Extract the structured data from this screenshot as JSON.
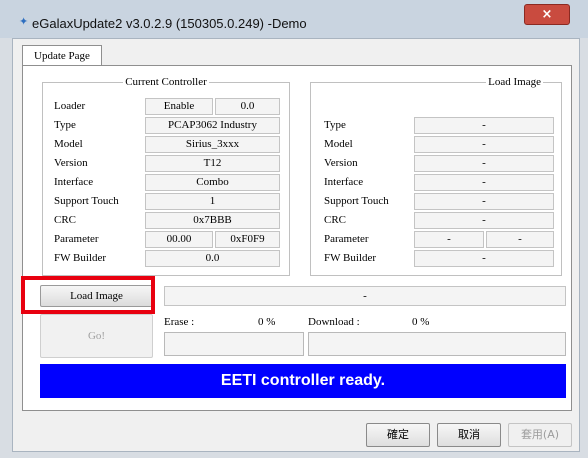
{
  "window": {
    "title": "eGalaxUpdate2 v3.0.2.9 (150305.0.249) -Demo",
    "close_glyph": "×"
  },
  "tabs": [
    {
      "label": "Update Page"
    }
  ],
  "current_controller": {
    "legend": "Current Controller",
    "rows": [
      {
        "label": "Loader",
        "value": "Enable",
        "value2": "0.0"
      },
      {
        "label": "Type",
        "value": "PCAP3062 Industry"
      },
      {
        "label": "Model",
        "value": "Sirius_3xxx"
      },
      {
        "label": "Version",
        "value": "T12"
      },
      {
        "label": "Interface",
        "value": "Combo"
      },
      {
        "label": "Support Touch",
        "value": "1"
      },
      {
        "label": "CRC",
        "value": "0x7BBB"
      },
      {
        "label": "Parameter",
        "value": "00.00",
        "value2": "0xF0F9"
      },
      {
        "label": "FW Builder",
        "value": "0.0"
      }
    ]
  },
  "load_image": {
    "legend": "Load Image",
    "rows": [
      {
        "label": "Type",
        "value": "-"
      },
      {
        "label": "Model",
        "value": "-"
      },
      {
        "label": "Version",
        "value": "-"
      },
      {
        "label": "Interface",
        "value": "-"
      },
      {
        "label": "Support Touch",
        "value": "-"
      },
      {
        "label": "CRC",
        "value": "-"
      },
      {
        "label": "Parameter",
        "value": "-",
        "value2": "-"
      },
      {
        "label": "FW Builder",
        "value": "-"
      }
    ]
  },
  "actions": {
    "load_image_button": "Load Image",
    "image_path": "-",
    "go_button": "Go!",
    "erase_label": "Erase :",
    "erase_percent": "0 %",
    "erase_progress": 0,
    "download_label": "Download :",
    "download_percent": "0 %",
    "download_progress": 0
  },
  "status": {
    "message": "EETI controller ready.",
    "color": "#0000ff"
  },
  "dialog_buttons": {
    "ok": "確定",
    "cancel": "取消",
    "apply": "套用(A)"
  },
  "colors": {
    "highlight": "#e8000f",
    "close_button": "#c94b3f"
  }
}
